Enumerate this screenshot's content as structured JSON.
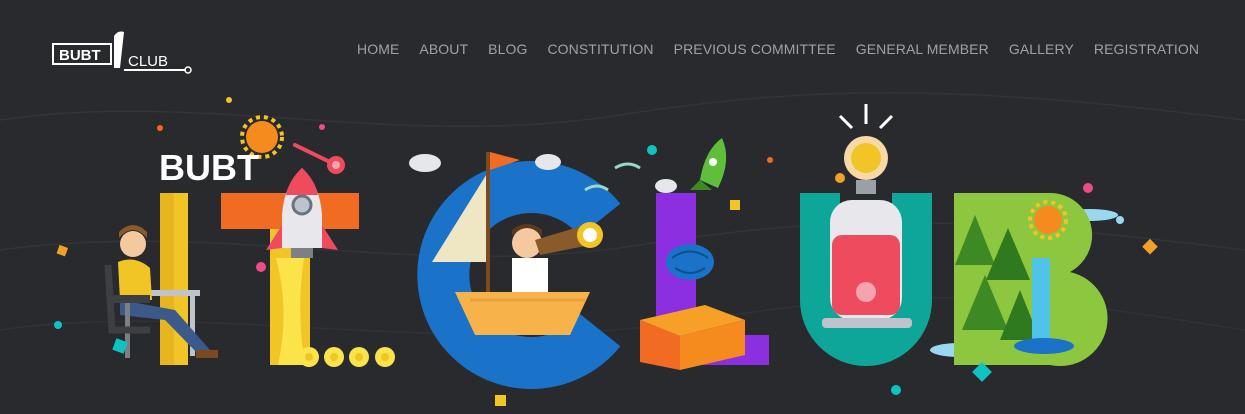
{
  "logo": {
    "text_left": "BUBT",
    "text_right": "CLUB"
  },
  "nav": {
    "items": [
      "HOME",
      "ABOUT",
      "BLOG",
      "CONSTITUTION",
      "PREVIOUS COMMITTEE",
      "GENERAL MEMBER",
      "GALLERY",
      "REGISTRATION"
    ]
  },
  "hero": {
    "subtitle": "BUBT"
  },
  "colors": {
    "background": "#282a2d",
    "nav_text": "#9ea2a7",
    "yellow": "#f2c526",
    "orange": "#f26b22",
    "blue": "#1a73c9",
    "purple": "#8b2fe0",
    "teal": "#0fa69a",
    "green": "#8dc63f"
  },
  "icons": [
    "rocket-icon",
    "sun-icon",
    "cloud-icon",
    "sailboat-icon",
    "lightbulb-icon",
    "brain-icon",
    "box-icon",
    "tree-icon",
    "waterfall-icon",
    "person-at-desk-icon",
    "spyglass-boy-icon",
    "astronaut-icon"
  ]
}
